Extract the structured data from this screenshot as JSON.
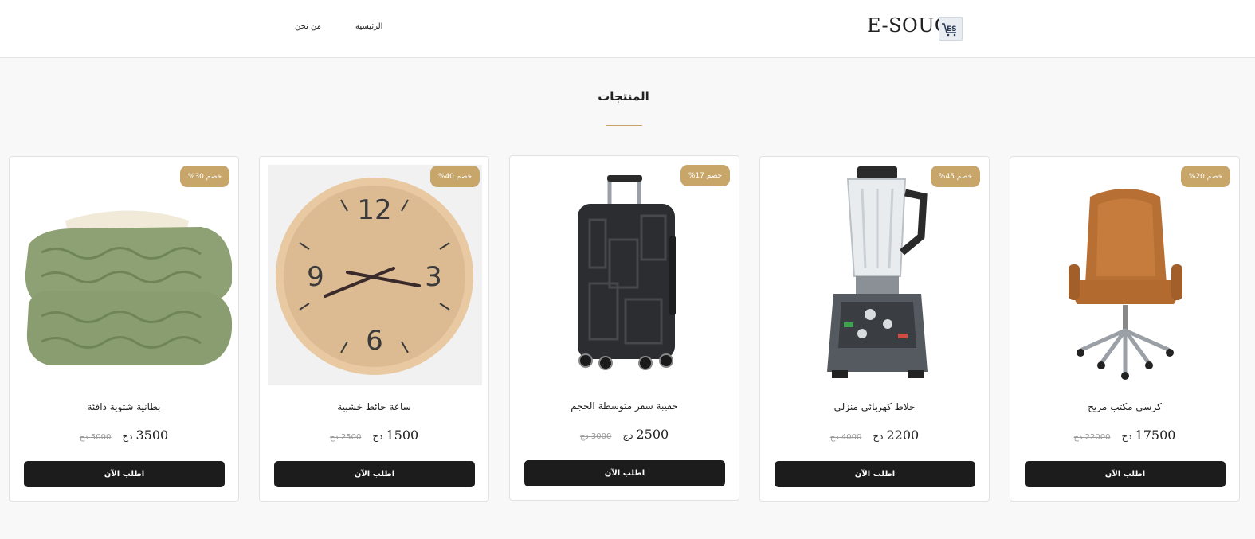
{
  "header": {
    "logo_text": "E-SOUQ",
    "logo_icon": "cart-es-logo-icon",
    "nav": {
      "home": "الرئيسية",
      "about": "من نحن"
    }
  },
  "section": {
    "title": "المنتجات"
  },
  "colors": {
    "accent": "#c8a66a",
    "button": "#1c1c1c",
    "page_bg": "#f8f8f8",
    "card_bg": "#ffffff"
  },
  "products": [
    {
      "name": "كرسي مكتب مريح",
      "price": "17500",
      "currency": "دج",
      "old_price": "22000 دج",
      "badge": "خصم 20%",
      "button": "اطلب الآن",
      "image": "office-chair-image"
    },
    {
      "name": "خلاط كهربائي منزلي",
      "price": "2200",
      "currency": "دج",
      "old_price": "4000 دج",
      "badge": "خصم 45%",
      "button": "اطلب الآن",
      "image": "blender-image"
    },
    {
      "name": "حقيبة سفر متوسطة الحجم",
      "price": "2500",
      "currency": "دج",
      "old_price": "3000 دج",
      "badge": "خصم 17%",
      "button": "اطلب الآن",
      "image": "suitcase-image"
    },
    {
      "name": "ساعة حائط خشبية",
      "price": "1500",
      "currency": "دج",
      "old_price": "2500 دج",
      "badge": "خصم 40%",
      "button": "اطلب الآن",
      "image": "wall-clock-image"
    },
    {
      "name": "بطانية شتوية دافئة",
      "price": "3500",
      "currency": "دج",
      "old_price": "5000 دج",
      "badge": "خصم 30%",
      "button": "اطلب الآن",
      "image": "blanket-image"
    }
  ]
}
